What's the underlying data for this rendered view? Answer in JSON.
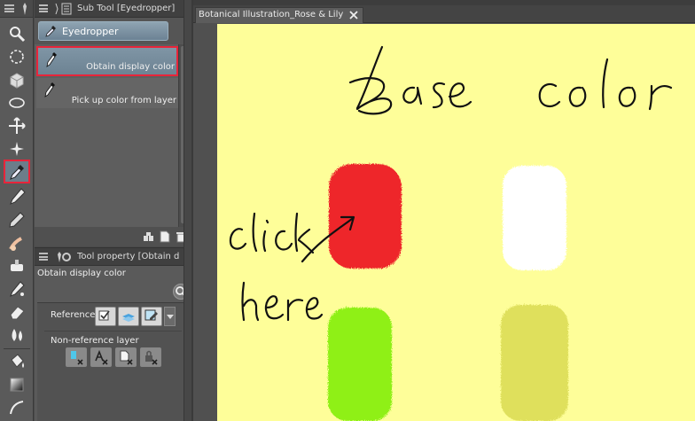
{
  "subtool_panel": {
    "title": "Sub Tool [Eyedropper]",
    "group_button": "Eyedropper",
    "items": [
      {
        "label": "Obtain display color",
        "selected": true
      },
      {
        "label": "Pick up color from layer",
        "selected": false
      }
    ]
  },
  "tool_property": {
    "title": "Tool property [Obtain d",
    "subtool_name": "Obtain display color",
    "reference_label": "Reference",
    "non_reference_label": "Non-reference layer"
  },
  "document": {
    "tab_title": "Botanical Illustration_Rose & Lily"
  },
  "canvas_colors": {
    "paper": "#fefe99",
    "swatch_red": "#ee2529",
    "swatch_white": "#ffffff",
    "swatch_green": "#8ff014",
    "swatch_olive": "#dfe05c"
  },
  "toolbox": {
    "tools": [
      "zoom-icon",
      "lasso-select-icon",
      "object-icon",
      "ellipse-select-icon",
      "move-icon",
      "magic-wand-icon",
      "eyedropper-icon",
      "pen-icon",
      "pencil-icon",
      "blend-icon",
      "airbrush-icon",
      "decoration-icon",
      "eraser-icon",
      "fill-drop-icon",
      "fill-bucket-icon",
      "gradient-icon",
      "curve-icon"
    ],
    "active_tool": "eyedropper-icon"
  }
}
